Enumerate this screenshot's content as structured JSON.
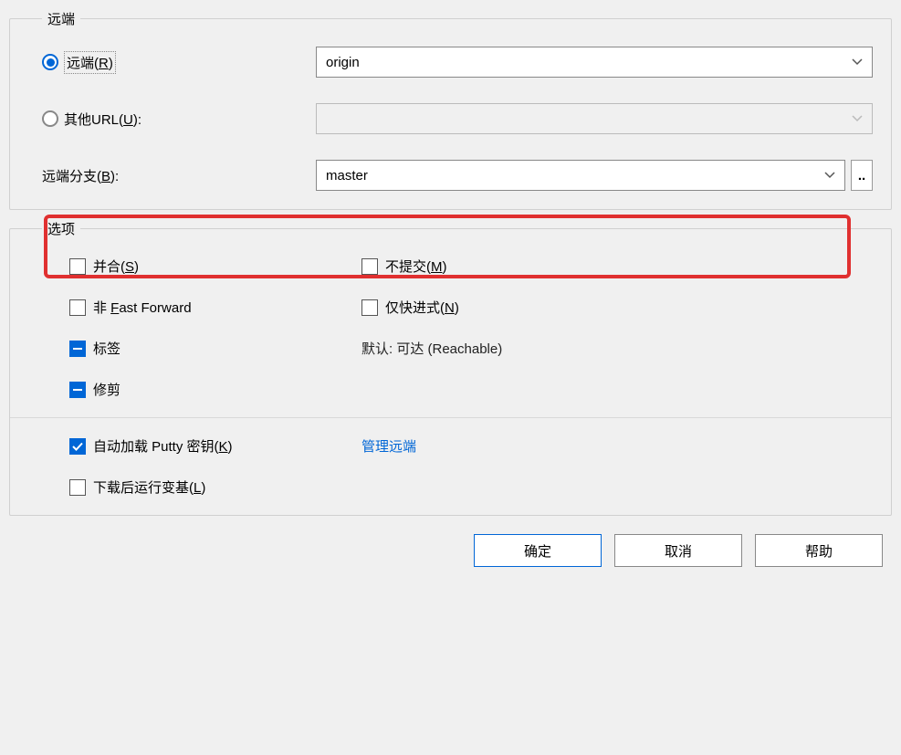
{
  "remote": {
    "legend": "远端",
    "radio_remote_label": "远端(R)",
    "radio_other_url_label": "其他URL(U):",
    "remote_value": "origin",
    "other_url_value": "",
    "branch_label": "远端分支(B):",
    "branch_value": "master"
  },
  "options": {
    "legend": "选项",
    "merge": "并合(S)",
    "no_commit": "不提交(M)",
    "no_ff": "非 Fast Forward",
    "ff_only": "仅快进式(N)",
    "tags": "标签",
    "tags_default": "默认: 可达 (Reachable)",
    "prune": "修剪",
    "autoload_putty": "自动加载 Putty 密钥(K)",
    "manage_remote": "管理远端",
    "rebase_after": "下载后运行变基(L)"
  },
  "buttons": {
    "ok": "确定",
    "cancel": "取消",
    "help": "帮助"
  }
}
